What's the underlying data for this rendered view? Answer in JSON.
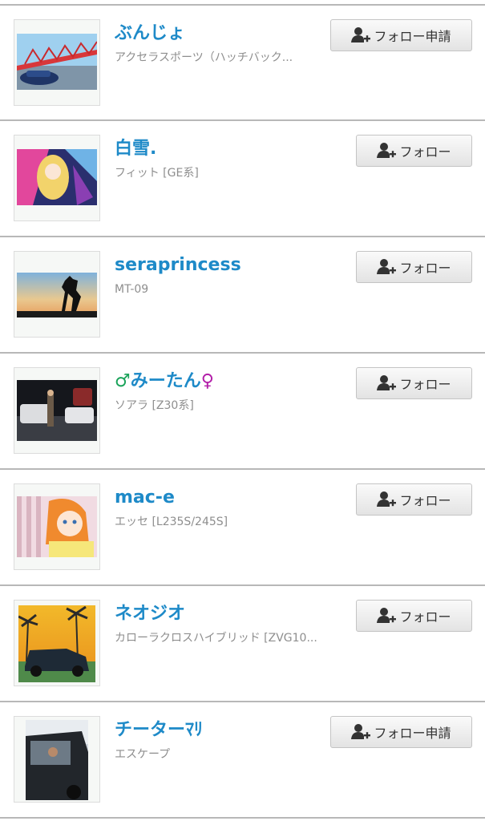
{
  "users": [
    {
      "name": "ぶんじょ",
      "name_prefix": "",
      "name_suffix": "",
      "subtitle": "アクセラスポーツ（ハッチバック...",
      "button_label": "フォロー申請",
      "button_icon": "add-user-icon",
      "button_type": "request",
      "avatar": "red-bridge-car-photo"
    },
    {
      "name": "白雪.",
      "name_prefix": "",
      "name_suffix": "",
      "subtitle": "フィット [GE系]",
      "button_label": "フォロー",
      "button_icon": "add-user-icon",
      "button_type": "follow",
      "avatar": "anime-girl-illustration"
    },
    {
      "name": "seraprincess",
      "name_prefix": "",
      "name_suffix": "",
      "subtitle": "MT-09",
      "button_label": "フォロー",
      "button_icon": "add-user-icon",
      "button_type": "follow",
      "avatar": "equestrian-statue-sunset"
    },
    {
      "name": "みーたん",
      "name_prefix": "♂",
      "name_suffix": "♀",
      "subtitle": "ソアラ [Z30系]",
      "button_label": "フォロー",
      "button_icon": "add-user-icon",
      "button_type": "follow",
      "avatar": "night-parking-cars"
    },
    {
      "name": "mac-e",
      "name_prefix": "",
      "name_suffix": "",
      "subtitle": "エッセ [L235S/245S]",
      "button_label": "フォロー",
      "button_icon": "add-user-icon",
      "button_type": "follow",
      "avatar": "anime-orange-hair-girl"
    },
    {
      "name": "ネオジオ",
      "name_prefix": "",
      "name_suffix": "",
      "subtitle": "カローラクロスハイブリッド [ZVG10...",
      "button_label": "フォロー",
      "button_icon": "add-user-icon",
      "button_type": "follow",
      "avatar": "palm-tree-car-illustration"
    },
    {
      "name": "チーターﾏﾘ",
      "name_prefix": "",
      "name_suffix": "",
      "subtitle": "エスケープ",
      "button_label": "フォロー申請",
      "button_icon": "add-user-icon",
      "button_type": "request",
      "avatar": "dark-car-photo"
    }
  ],
  "colors": {
    "name": "#1e8ac8",
    "subtitle": "#8e8e8e",
    "divider": "#b8b8b8",
    "male_symbol": "#1aa35a",
    "female_symbol": "#b21ea8"
  }
}
